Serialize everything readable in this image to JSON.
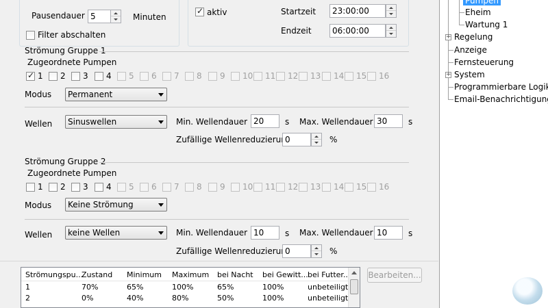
{
  "top": {
    "pause_label": "Pausendauer",
    "pause_value": "5",
    "pause_unit": "Minuten",
    "filter_off_label": "Filter abschalten",
    "aktiv_label": "aktiv",
    "start_label": "Startzeit",
    "start_value": "23:00:00",
    "end_label": "Endzeit",
    "end_value": "06:00:00"
  },
  "group1": {
    "title": "Strömung Gruppe 1",
    "pumps_label": "Zugeordnete Pumpen",
    "pumps": [
      "1",
      "2",
      "3",
      "4",
      "5",
      "6",
      "7",
      "8",
      "9",
      "10",
      "11",
      "12",
      "13",
      "14",
      "15",
      "16"
    ],
    "checked": [
      true,
      false,
      false,
      false,
      false,
      false,
      false,
      false,
      false,
      false,
      false,
      false,
      false,
      false,
      false,
      false
    ],
    "mode_label": "Modus",
    "mode_value": "Permanent",
    "waves_label": "Wellen",
    "waves_value": "Sinuswellen",
    "min_label": "Min. Wellendauer",
    "min_value": "20",
    "min_unit": "s",
    "max_label": "Max. Wellendauer",
    "max_value": "30",
    "max_unit": "s",
    "random_label": "Zufällige Wellenreduzierung",
    "random_value": "0",
    "random_unit": "%"
  },
  "group2": {
    "title": "Strömung Gruppe 2",
    "pumps_label": "Zugeordnete Pumpen",
    "pumps": [
      "1",
      "2",
      "3",
      "4",
      "5",
      "6",
      "7",
      "8",
      "9",
      "10",
      "11",
      "12",
      "13",
      "14",
      "15",
      "16"
    ],
    "checked": [
      false,
      false,
      false,
      false,
      false,
      false,
      false,
      false,
      false,
      false,
      false,
      false,
      false,
      false,
      false,
      false
    ],
    "mode_label": "Modus",
    "mode_value": "Keine Strömung",
    "waves_label": "Wellen",
    "waves_value": "keine Wellen",
    "min_label": "Min. Wellendauer",
    "min_value": "10",
    "min_unit": "s",
    "max_label": "Max. Wellendauer",
    "max_value": "10",
    "max_unit": "s",
    "random_label": "Zufällige Wellenreduzierung",
    "random_value": "0",
    "random_unit": "%"
  },
  "table": {
    "headers": [
      "Strömungspu...",
      "Zustand",
      "Minimum",
      "Maximum",
      "bei Nacht",
      "bei Gewitt...",
      "bei Futter..."
    ],
    "rows": [
      [
        "1",
        "70%",
        "65%",
        "100%",
        "65%",
        "100%",
        "unbeteiligt"
      ],
      [
        "2",
        "0%",
        "40%",
        "80%",
        "50%",
        "100%",
        "unbeteiligt"
      ]
    ]
  },
  "edit_button": "Bearbeiten...",
  "tree": {
    "pumpen": "Pumpen",
    "eheim": "Eheim",
    "wartung": "Wartung 1",
    "regelung": "Regelung",
    "anzeige": "Anzeige",
    "fernsteuerung": "Fernsteuerung",
    "system": "System",
    "logik": "Programmierbare Logik",
    "email": "Email-Benachrichtigung"
  }
}
